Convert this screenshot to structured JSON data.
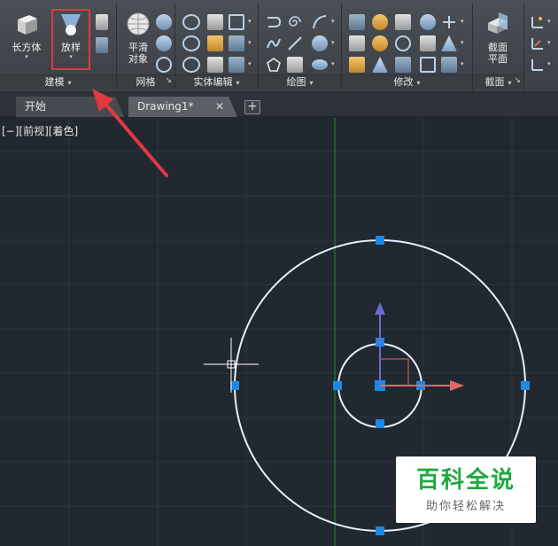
{
  "ribbon": {
    "panels": {
      "modeling": "建模",
      "mesh": "网格",
      "solid_editing": "实体编辑",
      "draw": "绘图",
      "modify": "修改",
      "section": "截面"
    },
    "buttons": {
      "box": "长方体",
      "loft": "放样",
      "smooth_object": [
        "平滑",
        "对象"
      ],
      "section_plane": [
        "截面",
        "平面"
      ]
    },
    "dropdown_glyph": "▾",
    "launcher_glyph": "↘"
  },
  "tabs": {
    "start": "开始",
    "drawing": "Drawing1*",
    "close_glyph": "✕",
    "new_glyph": "+"
  },
  "viewport": {
    "label": "[−][前视][着色]"
  },
  "colors": {
    "background": "#212830",
    "grid_major": "#2c3440",
    "circle": "#e6f0ff",
    "grip": "#1e88e5",
    "axis_y_line": "#1f8a3a",
    "gizmo_up": "#6a6bd9",
    "gizmo_right": "#e06a6a",
    "annotation_arrow": "#e2383f",
    "highlight": "#e2383f"
  },
  "watermark": {
    "title": "百科全说",
    "subtitle": "助你轻松解决"
  }
}
